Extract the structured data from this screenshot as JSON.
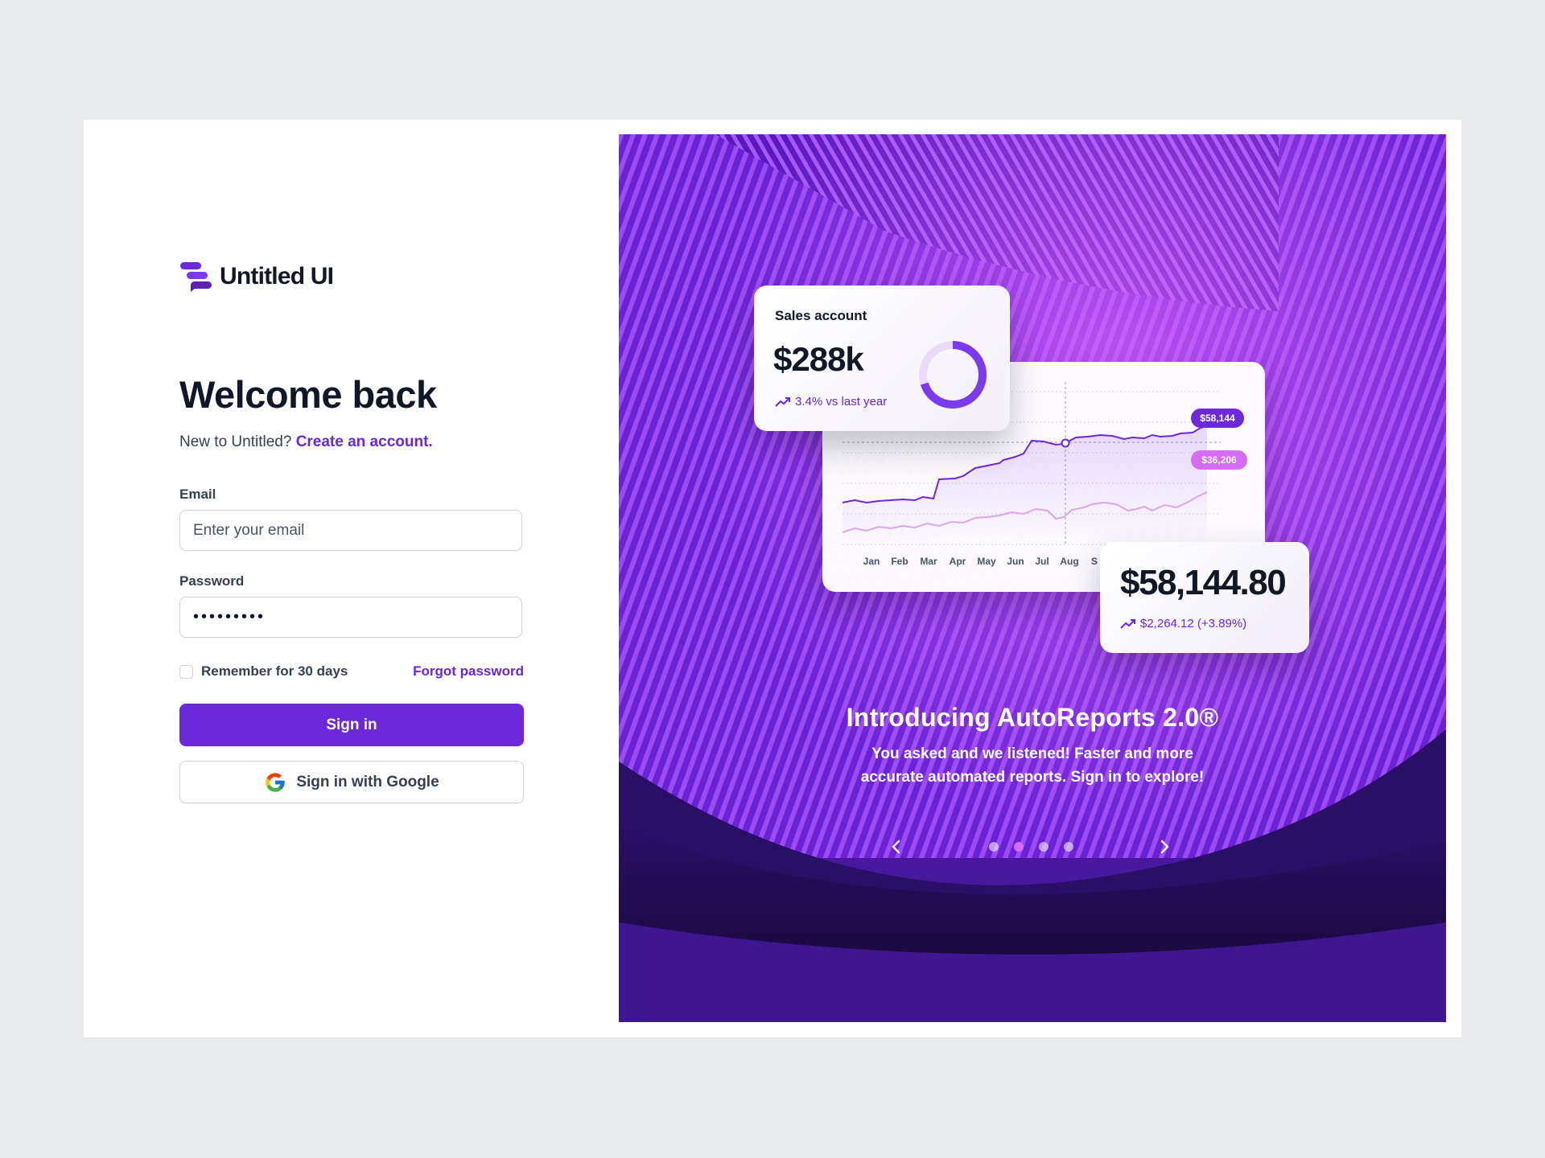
{
  "brand": {
    "name": "Untitled UI"
  },
  "form": {
    "title": "Welcome back",
    "subtitle_prefix": "New to Untitled?",
    "create_account_link": "Create an account.",
    "email_label": "Email",
    "email_placeholder": "Enter your email",
    "email_value": "",
    "password_label": "Password",
    "password_value": "•••••••••",
    "remember_label": "Remember for 30 days",
    "remember_checked": false,
    "forgot_link": "Forgot password",
    "sign_in_button": "Sign in",
    "google_button": "Sign in with Google"
  },
  "promo": {
    "sales_card": {
      "title": "Sales account",
      "value": "$288k",
      "trend": "3.4% vs last year",
      "donut_fraction": 0.7
    },
    "chart_card": {
      "months": [
        "Jan",
        "Feb",
        "Mar",
        "Apr",
        "May",
        "Jun",
        "Jul",
        "Aug",
        "S"
      ],
      "series_top_tag": "$58,144",
      "series_bottom_tag": "$36,206"
    },
    "value_card": {
      "value": "$58,144.80",
      "trend": "$2,264.12 (+3.89%)"
    },
    "headline": "Introducing AutoReports 2.0®",
    "body": "You asked and we listened! Faster and more accurate automated reports. Sign in to explore!",
    "carousel": {
      "total": 4,
      "active_index": 1
    }
  },
  "colors": {
    "brand_purple": "#6d28d9",
    "link_purple": "#6927da",
    "dot_active": "#d66bf5"
  }
}
